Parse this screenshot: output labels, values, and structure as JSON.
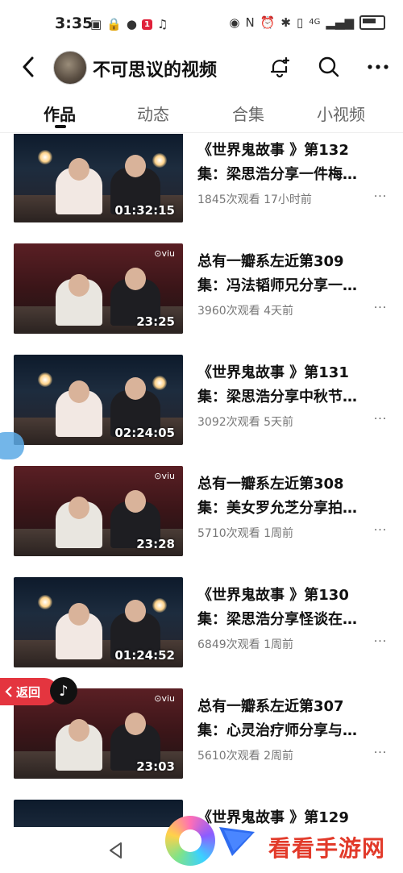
{
  "status_bar": {
    "time": "3:35",
    "badge": "1",
    "network": "4G"
  },
  "header": {
    "title": "不可思议的视频"
  },
  "tabs": [
    {
      "label": "作品",
      "active": true
    },
    {
      "label": "动态",
      "active": false
    },
    {
      "label": "合集",
      "active": false
    },
    {
      "label": "小视频",
      "active": false
    }
  ],
  "videos": [
    {
      "title": "《世界鬼故事 》第132\n集：梁思浩分享一件梅…",
      "duration": "01:32:15",
      "views": "1845次观看",
      "time_ago": "17小时前",
      "style": "night",
      "viu": false
    },
    {
      "title": "总有一瓣系左近第309\n集：冯法韬师兄分享一…",
      "duration": "23:25",
      "views": "3960次观看",
      "time_ago": "4天前",
      "style": "red",
      "viu": true
    },
    {
      "title": "《世界鬼故事 》第131\n集：梁思浩分享中秋节…",
      "duration": "02:24:05",
      "views": "3092次观看",
      "time_ago": "5天前",
      "style": "night",
      "viu": false
    },
    {
      "title": "总有一瓣系左近第308\n集：美女罗允芝分享拍…",
      "duration": "23:28",
      "views": "5710次观看",
      "time_ago": "1周前",
      "style": "red",
      "viu": true
    },
    {
      "title": "《世界鬼故事 》第130\n集：梁思浩分享怪谈在…",
      "duration": "01:24:52",
      "views": "6849次观看",
      "time_ago": "1周前",
      "style": "night",
      "viu": false
    },
    {
      "title": "总有一瓣系左近第307\n集：心灵治疗师分享与…",
      "duration": "23:03",
      "views": "5610次观看",
      "time_ago": "2周前",
      "style": "red",
      "viu": true
    }
  ],
  "partial_title": "《世界鬼故事 》第129",
  "viu_label": "viu",
  "more_label": "···",
  "return_button": {
    "label": "返回"
  },
  "tiktok_glyph": "♪",
  "watermark": {
    "text": "看看手游网"
  },
  "colors": {
    "accent_red": "#e4353f",
    "watermark_red": "#e23a2a"
  }
}
